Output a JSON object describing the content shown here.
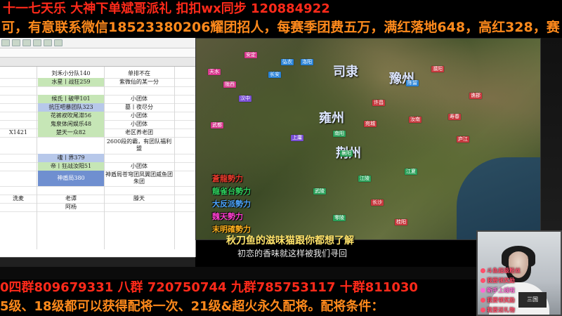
{
  "banners": {
    "top1": "十一七天乐 大神下单斌哥派礼 扣扣wx同步 120884922",
    "top2": "可，有意联系微信18523380206耀团招人，每赛季团费五万，满红落地648，高红328，赛",
    "bottom1": "0四群809679331 八群 720750744 九群785753117   十群811030",
    "bottom2": "5级、18级都可以获得配将一次、21级&超火永久配将。配将条件："
  },
  "sheet": {
    "rows": [
      {
        "a": "",
        "b": "刘禾小分队140",
        "c": "单排不在",
        "b_style": "plain"
      },
      {
        "a": "",
        "b": "水星丨战狂259",
        "c": "紫微仙的某一分",
        "b_style": "green"
      },
      {
        "a": "",
        "b": "",
        "c": "",
        "b_style": "plain"
      },
      {
        "a": "",
        "b": "候氏丨破甲101",
        "c": "小团体",
        "b_style": "green"
      },
      {
        "a": "",
        "b": "抗压吧暴团队323",
        "c": "墓丨夜尽分",
        "b_style": "blue"
      },
      {
        "a": "",
        "b": "花裤衩吹尾滞56",
        "c": "小团体",
        "b_style": "green"
      },
      {
        "a": "",
        "b": "鬼泉体闲娱乐48",
        "c": "小团体",
        "b_style": "green"
      },
      {
        "a": "X1421",
        "b": "楚天一众82",
        "c": "老区养老团",
        "b_style": "green"
      },
      {
        "a": "",
        "b": "",
        "c": "2600段的霸，有团队福利盟",
        "b_style": "plain"
      },
      {
        "a": "",
        "b": "魂丨界379",
        "c": "",
        "b_style": "blue"
      },
      {
        "a": "",
        "b": "帝丨狂战汝阳51",
        "c": "小团体",
        "b_style": "green"
      },
      {
        "a": "",
        "b": "神盾局380",
        "c": "神盾局苍穹团凤翼团威鱼团朱团",
        "b_style": "blue_dark"
      },
      {
        "a": "",
        "b": "",
        "c": "",
        "b_style": "plain"
      },
      {
        "a": "洗麦",
        "b": "老谭",
        "c": "滕天",
        "b_style": "plain"
      },
      {
        "a": "",
        "b": "阿杨",
        "c": "",
        "b_style": "plain"
      }
    ]
  },
  "map": {
    "regions": [
      {
        "name": "司隶"
      },
      {
        "name": "豫州"
      },
      {
        "name": "雍州"
      },
      {
        "name": "荆州"
      }
    ],
    "cities": [
      {
        "label": "天水",
        "color": "#d83a8f"
      },
      {
        "label": "陇西",
        "color": "#d83a8f"
      },
      {
        "label": "汉中",
        "color": "#7a4fd6"
      },
      {
        "label": "长安",
        "color": "#2b84d8"
      },
      {
        "label": "洛阳",
        "color": "#2b84d8"
      },
      {
        "label": "许昌",
        "color": "#c7383e"
      },
      {
        "label": "南阳",
        "color": "#2aa05a"
      },
      {
        "label": "宛城",
        "color": "#c7383e"
      },
      {
        "label": "襄阳",
        "color": "#2aa05a"
      },
      {
        "label": "江陵",
        "color": "#2aa05a"
      },
      {
        "label": "汝南",
        "color": "#c7383e"
      },
      {
        "label": "寿春",
        "color": "#c7383e"
      },
      {
        "label": "庐江",
        "color": "#c7383e"
      },
      {
        "label": "陈留",
        "color": "#2b84d8"
      },
      {
        "label": "濮阳",
        "color": "#c7383e"
      },
      {
        "label": "谯郡",
        "color": "#c7383e"
      },
      {
        "label": "武陵",
        "color": "#2aa05a"
      },
      {
        "label": "长沙",
        "color": "#c7383e"
      },
      {
        "label": "零陵",
        "color": "#2aa05a"
      },
      {
        "label": "桂阳",
        "color": "#c7383e"
      },
      {
        "label": "江夏",
        "color": "#2aa05a"
      },
      {
        "label": "上庸",
        "color": "#7a4fd6"
      },
      {
        "label": "武都",
        "color": "#d83a8f"
      },
      {
        "label": "安定",
        "color": "#d83a8f"
      },
      {
        "label": "弘农",
        "color": "#2b84d8"
      }
    ],
    "legend": [
      {
        "text": "蒼龍勢力",
        "color": "#e63a2c"
      },
      {
        "text": "龍雀台勢力",
        "color": "#2ed15e"
      },
      {
        "text": "大反派勢力",
        "color": "#4da6ff"
      },
      {
        "text": "魏天勢力",
        "color": "#ff3fd0"
      },
      {
        "text": "末明確勢力",
        "color": "#ffb21e"
      }
    ]
  },
  "subtitles": {
    "line1": "秋刀鱼的滋味猫跟你都想了解",
    "line2": "初恋的香味就这样被我们寻回"
  },
  "webcam": {
    "sign": "三国",
    "overlays": [
      {
        "text": "斗鱼超级粉丝",
        "color": "#ff4d6a"
      },
      {
        "text": "我要领奖励",
        "color": "#ff4d6a"
      },
      {
        "text": "新手上线啦",
        "color": "#ff6bd0"
      },
      {
        "text": "我要领奖励",
        "color": "#ff4d6a"
      },
      {
        "text": "我要送礼物",
        "color": "#ff4d6a"
      }
    ]
  }
}
